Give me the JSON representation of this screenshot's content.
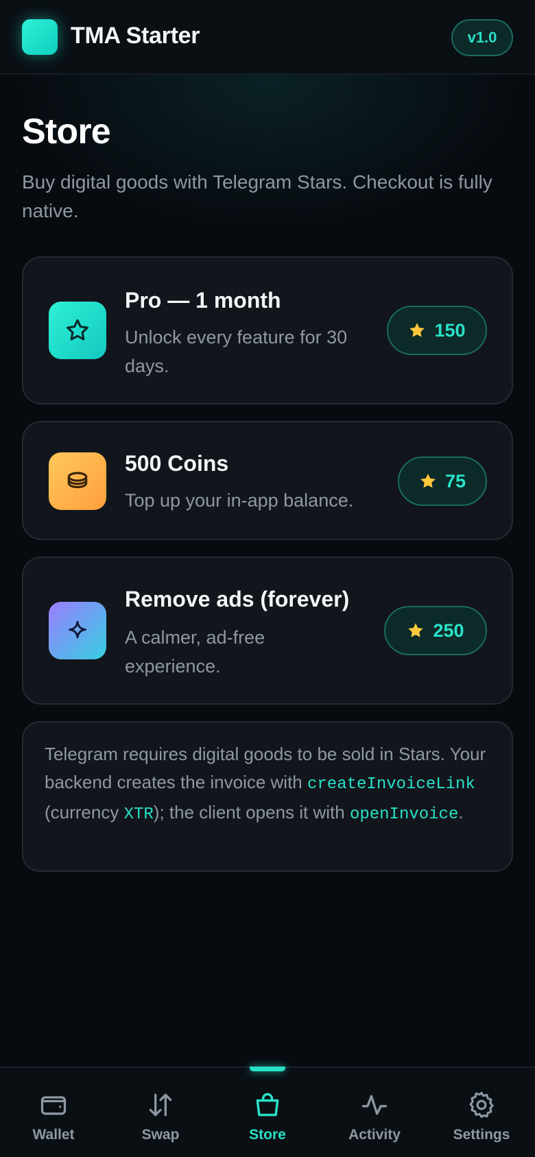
{
  "header": {
    "app_title": "TMA Starter",
    "version": "v1.0",
    "accent": "#28e0c6"
  },
  "page": {
    "title": "Store",
    "subtitle": "Buy digital goods with Telegram Stars. Checkout is fully native."
  },
  "products": [
    {
      "name": "Pro — 1 month",
      "description": "Unlock every feature for 30 days.",
      "price": "150",
      "icon": "star-icon",
      "icon_gradient": [
        "#2ef0d6",
        "#14c8bf"
      ]
    },
    {
      "name": "500 Coins",
      "description": "Top up your in-app balance.",
      "price": "75",
      "icon": "coins-icon",
      "icon_gradient": [
        "#ffc85a",
        "#ff9f3d"
      ]
    },
    {
      "name": "Remove ads (forever)",
      "description": "A calmer, ad-free experience.",
      "price": "250",
      "icon": "sparkle-icon",
      "icon_gradient": [
        "#9b7dff",
        "#35cfe0"
      ]
    }
  ],
  "note": {
    "text_1": "Telegram requires digital goods to be sold in Stars. Your backend creates the invoice with ",
    "code_1": "createInvoiceLink",
    "text_2": " (currency ",
    "code_2": "XTR",
    "text_3": "); the client opens it with ",
    "code_3": "openInvoice",
    "text_4": "."
  },
  "nav": {
    "active": "Store",
    "items": [
      {
        "label": "Wallet",
        "icon": "wallet-icon"
      },
      {
        "label": "Swap",
        "icon": "swap-icon"
      },
      {
        "label": "Store",
        "icon": "shopping-bag-icon"
      },
      {
        "label": "Activity",
        "icon": "activity-icon"
      },
      {
        "label": "Settings",
        "icon": "gear-icon"
      }
    ]
  },
  "colors": {
    "star": "#ffc83d",
    "price_text": "#2ae2c8"
  }
}
